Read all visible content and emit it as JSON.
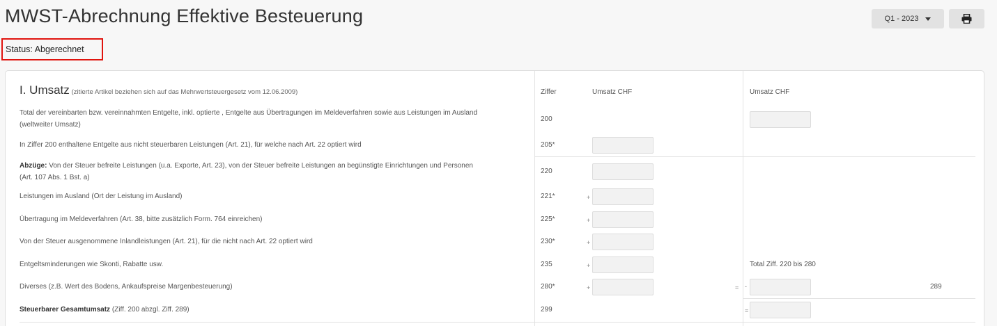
{
  "header": {
    "title": "MWST-Abrechnung Effektive Besteuerung",
    "period": "Q1 - 2023",
    "status": "Status: Abgerechnet"
  },
  "table": {
    "section_title": "I. Umsatz",
    "section_sub": "(zitierte Artikel beziehen sich auf das Mehrwertsteuergesetz vom 12.06.2009)",
    "col_ziffer": "Ziffer",
    "col_umsatz1": "Umsatz CHF",
    "col_umsatz2": "Umsatz CHF",
    "rows": [
      {
        "text1": "Total der vereinbarten bzw. vereinnahmten Entgelte, inkl. optierte , Entgelte aus Übertragungen im Meldeverfahren sowie aus Leistungen im Ausland",
        "text2": "(weltweiter Umsatz)",
        "ziffer": "200"
      },
      {
        "text1": "In Ziffer 200 enthaltene Entgelte aus nicht steuerbaren Leistungen (Art. 21), für welche nach Art. 22 optiert wird",
        "ziffer": "205*"
      },
      {
        "bold": "Abzüge:",
        "text1": " Von der Steuer befreite Leistungen (u.a. Exporte, Art. 23), von der Steuer befreite Leistungen an begünstigte Einrichtungen und Personen",
        "text2": "(Art. 107 Abs. 1 Bst. a)",
        "ziffer": "220"
      },
      {
        "text1": "Leistungen im Ausland (Ort der Leistung im Ausland)",
        "ziffer": "221*",
        "op": "+"
      },
      {
        "text1": "Übertragung im Meldeverfahren (Art. 38, bitte zusätzlich Form. 764 einreichen)",
        "ziffer": "225*",
        "op": "+"
      },
      {
        "text1": "Von der Steuer ausgenommene Inlandleistungen (Art. 21), für die nicht nach Art. 22 optiert wird",
        "ziffer": "230*",
        "op": "+"
      },
      {
        "text1": "Entgeltsminderungen wie Skonti, Rabatte usw.",
        "ziffer": "235",
        "op": "+",
        "total_label": "Total Ziff. 220 bis 280"
      },
      {
        "text1": "Diverses (z.B. Wert des Bodens, Ankaufspreise Margenbesteuerung)",
        "ziffer": "280*",
        "op": "+",
        "eq": "=",
        "minus": "-",
        "ref": "289"
      },
      {
        "bold": "Steuerbarer Gesamtumsatz",
        "text1": " (Ziff. 200 abzgl. Ziff. 289)",
        "ziffer": "299",
        "eq": "="
      }
    ]
  }
}
